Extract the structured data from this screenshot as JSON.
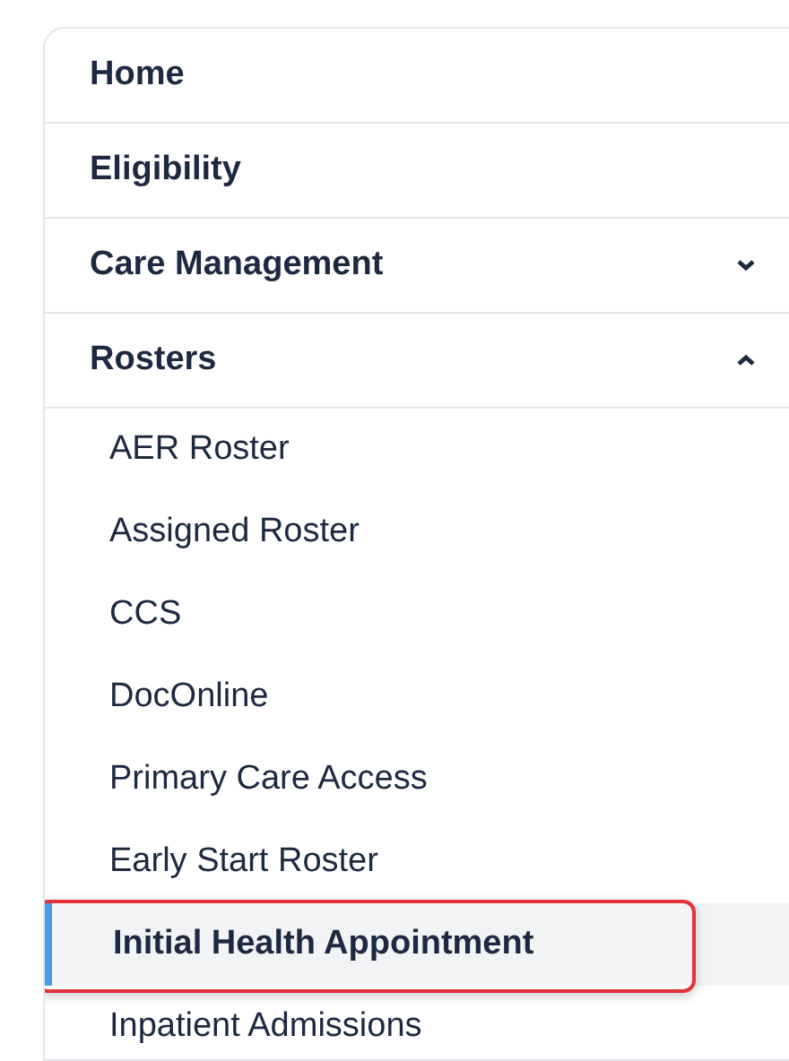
{
  "items": [
    {
      "label": "Home",
      "selected": false
    },
    {
      "label": "Eligibility",
      "selected": false
    },
    {
      "label": "Care Management",
      "selected": false,
      "expanded": false
    },
    {
      "label": "Rosters",
      "selected": false,
      "expanded": true,
      "children": [
        {
          "label": "AER Roster",
          "selected": false,
          "highlighted": false
        },
        {
          "label": "Assigned Roster",
          "selected": false,
          "highlighted": false
        },
        {
          "label": "CCS",
          "selected": false,
          "highlighted": false
        },
        {
          "label": "DocOnline",
          "selected": false,
          "highlighted": false
        },
        {
          "label": "Primary Care Access",
          "selected": false,
          "highlighted": false
        },
        {
          "label": "Early Start Roster",
          "selected": false,
          "highlighted": false
        },
        {
          "label": "Initial Health Appointment",
          "selected": true,
          "highlighted": true
        },
        {
          "label": "Inpatient Admissions",
          "selected": false,
          "highlighted": false
        }
      ]
    }
  ]
}
